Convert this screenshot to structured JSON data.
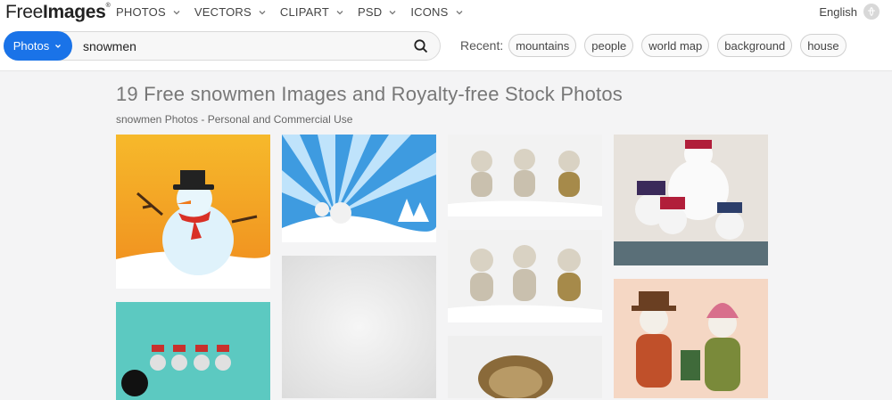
{
  "header": {
    "logo_light": "Free",
    "logo_bold": "Images",
    "logo_mark": "®",
    "nav": [
      {
        "label": "PHOTOS"
      },
      {
        "label": "VECTORS"
      },
      {
        "label": "CLIPART"
      },
      {
        "label": "PSD"
      },
      {
        "label": "ICONS"
      }
    ],
    "language": "English"
  },
  "search": {
    "type_label": "Photos",
    "query": "snowmen"
  },
  "recent": {
    "label": "Recent:",
    "chips": [
      "mountains",
      "people",
      "world map",
      "background",
      "house"
    ]
  },
  "main": {
    "title": "19 Free snowmen Images and Royalty-free Stock Photos",
    "subtitle": "snowmen Photos - Personal and Commercial Use"
  },
  "colors": {
    "accent": "#1a73e8",
    "title": "#777777"
  },
  "icons": {
    "search": "search-icon",
    "chevron": "chevron-down-icon",
    "globe": "globe-icon"
  }
}
